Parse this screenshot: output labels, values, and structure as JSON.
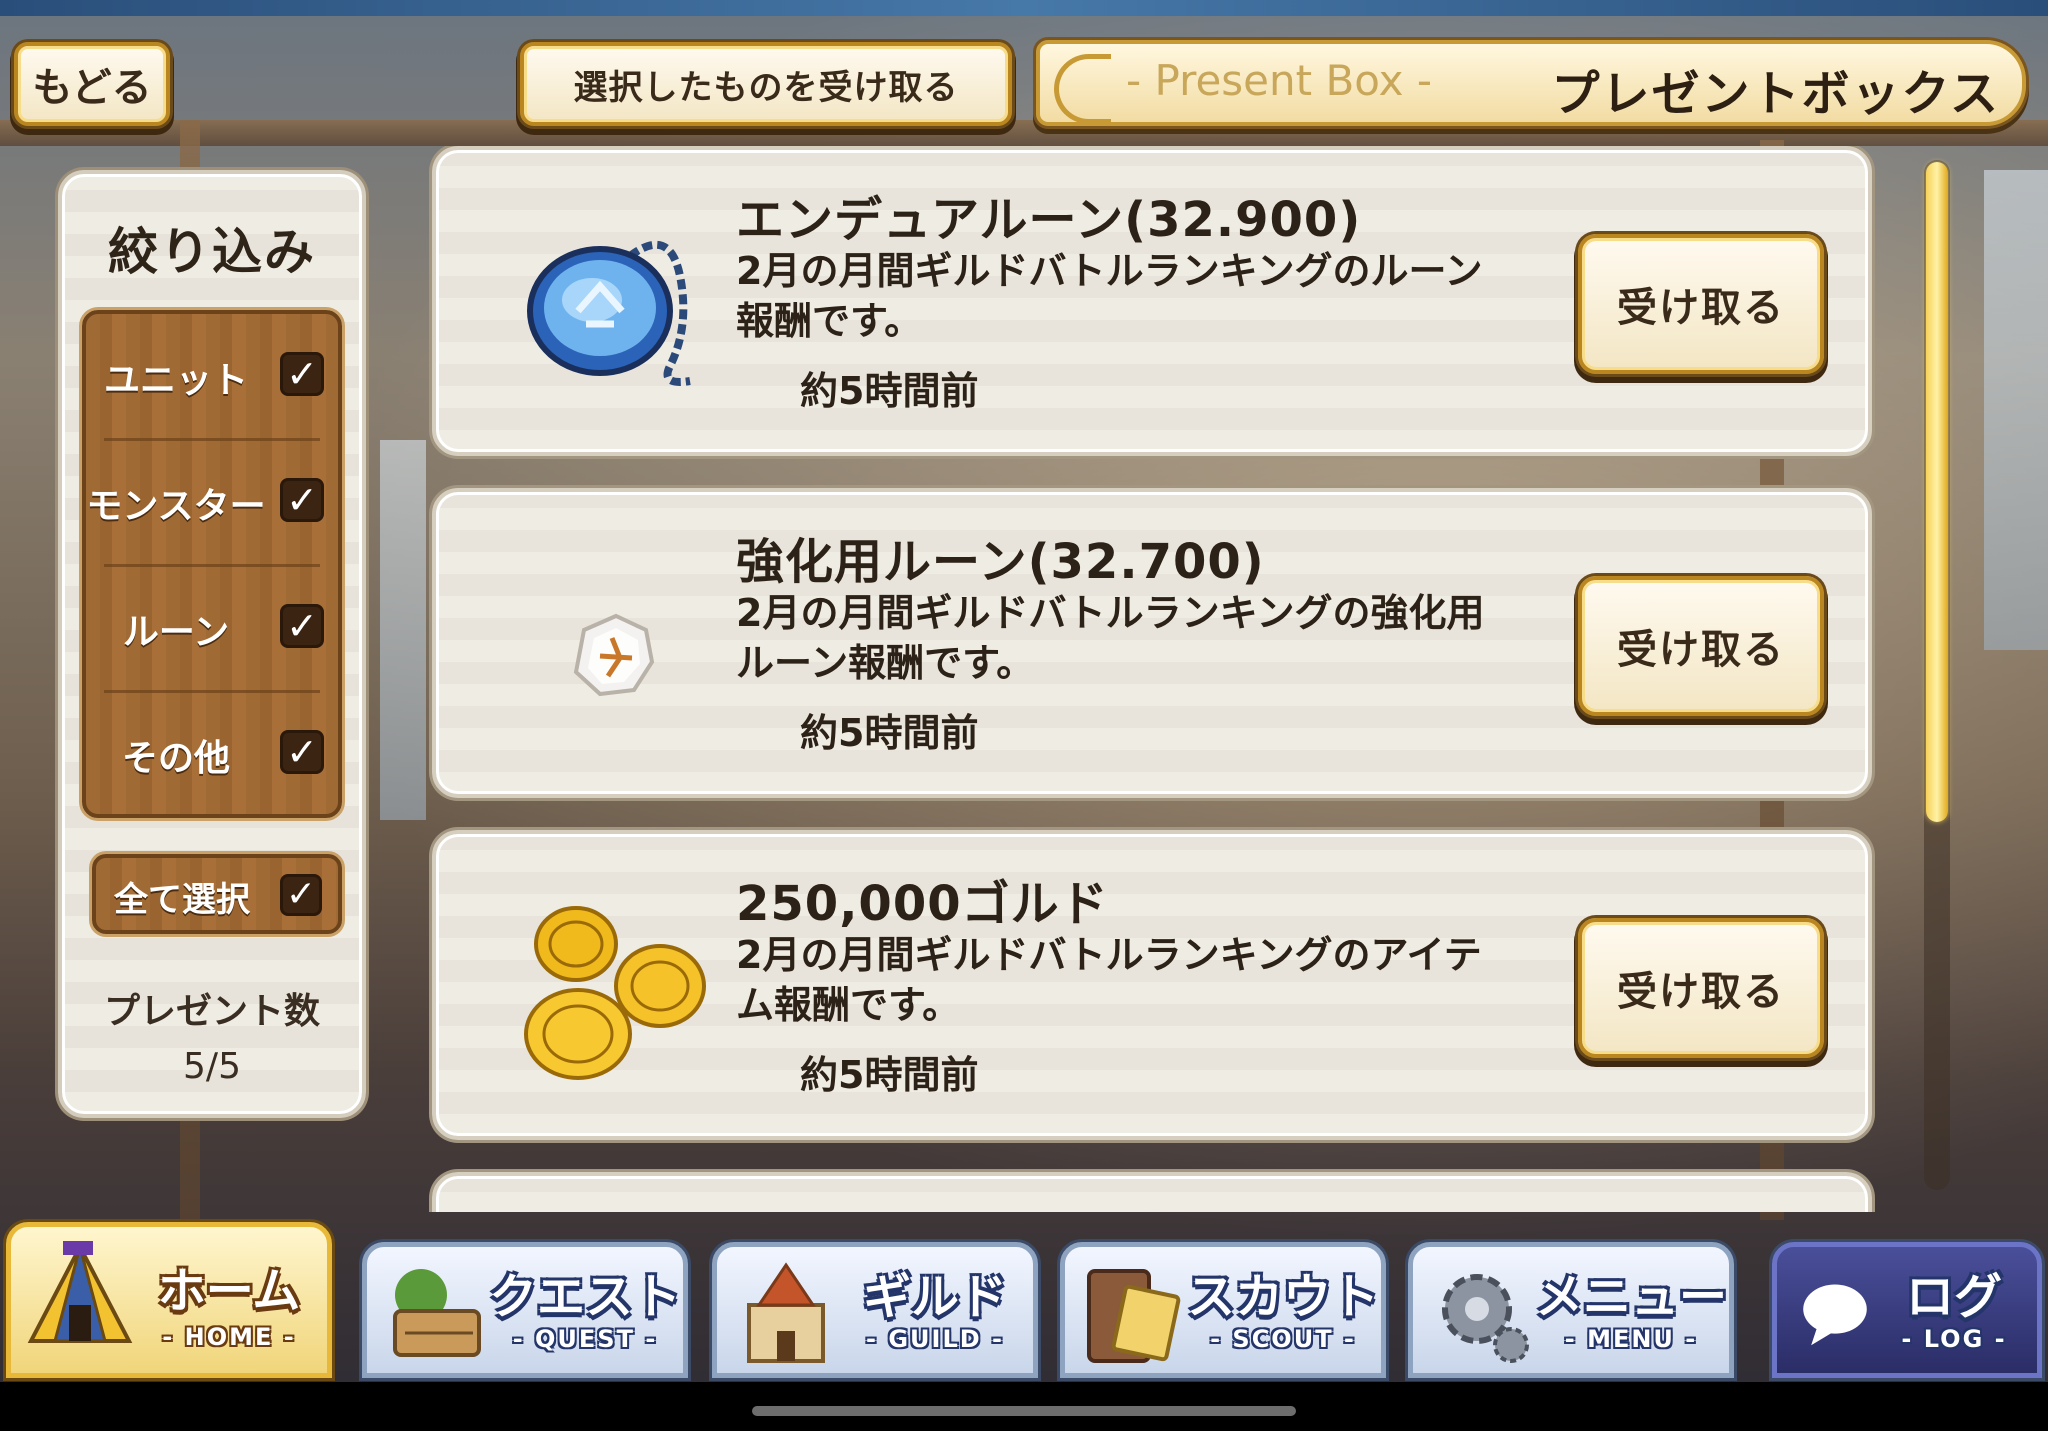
{
  "header": {
    "back_label": "もどる",
    "receive_selected_label": "選択したものを受け取る",
    "title_en": "- Present Box -",
    "title_jp": "プレゼントボックス"
  },
  "filter": {
    "title": "絞り込み",
    "items": [
      {
        "label": "ユニット",
        "checked": true
      },
      {
        "label": "モンスター",
        "checked": true
      },
      {
        "label": "ルーン",
        "checked": true
      },
      {
        "label": "その他",
        "checked": true
      }
    ],
    "checkmark": "✓",
    "select_all_label": "全て選択",
    "present_count_label": "プレゼント数",
    "present_count_value": "5/5"
  },
  "presents": [
    {
      "icon": "endure-rune-amulet-icon",
      "name": "エンデュアルーン(32.900)",
      "description": "2月の月間ギルドバトルランキングのルーン報酬です。",
      "time": "約5時間前",
      "button": "受け取る"
    },
    {
      "icon": "enhancement-rune-crystal-icon",
      "name": "強化用ルーン(32.700)",
      "description": "2月の月間ギルドバトルランキングの強化用ルーン報酬です。",
      "time": "約5時間前",
      "button": "受け取る"
    },
    {
      "icon": "gold-coins-icon",
      "name": "250,000ゴルド",
      "description": "2月の月間ギルドバトルランキングのアイテム報酬です。",
      "time": "約5時間前",
      "button": "受け取る"
    }
  ],
  "nav": [
    {
      "jp": "ホーム",
      "en": "- HOME -",
      "icon": "tent-icon",
      "active": true
    },
    {
      "jp": "クエスト",
      "en": "- QUEST -",
      "icon": "quest-map-icon",
      "active": false
    },
    {
      "jp": "ギルド",
      "en": "- GUILD -",
      "icon": "castle-icon",
      "active": false
    },
    {
      "jp": "スカウト",
      "en": "- SCOUT -",
      "icon": "scout-scroll-icon",
      "active": false
    },
    {
      "jp": "メニュー",
      "en": "- MENU -",
      "icon": "gear-icon",
      "active": false
    },
    {
      "jp": "ログ",
      "en": "- LOG -",
      "icon": "chat-bubble-icon",
      "active": false
    }
  ],
  "colors": {
    "gold_frame": "#b9861f",
    "panel_bg": "#efece4",
    "wood": "#a06a34",
    "text_dark": "#2c2218",
    "scroll_thumb": "#f7d25a",
    "nav_active": "#f0d57a",
    "nav_log": "#2a2d66"
  }
}
